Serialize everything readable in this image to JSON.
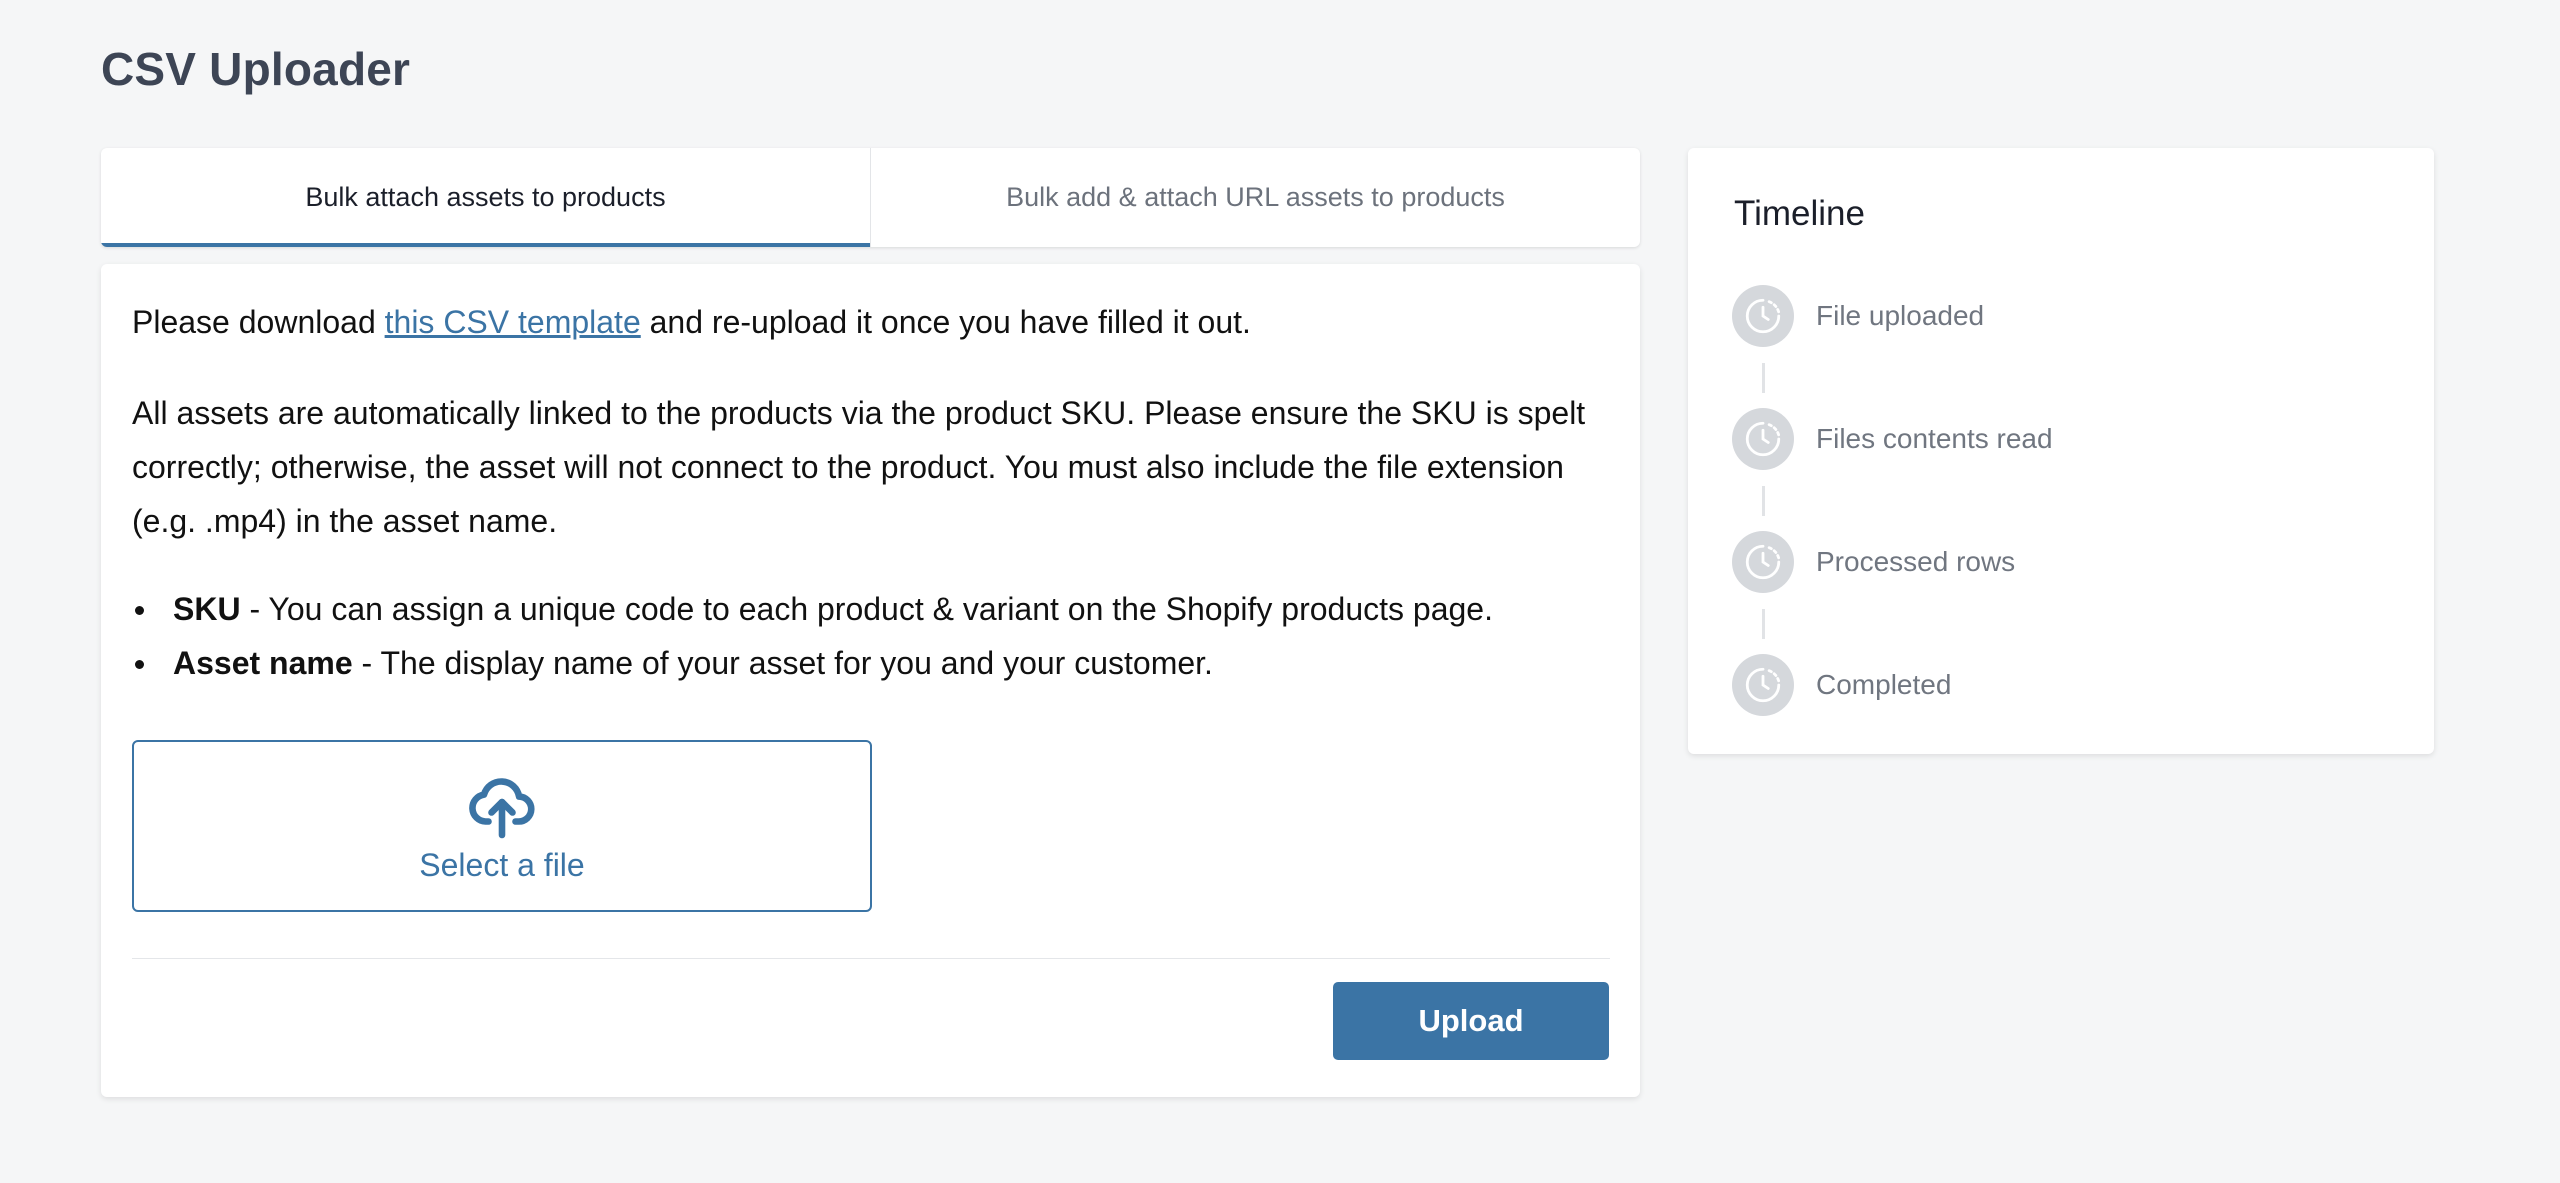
{
  "page": {
    "title": "CSV Uploader"
  },
  "tabs": [
    {
      "label": "Bulk attach assets to products",
      "active": true
    },
    {
      "label": "Bulk add & attach URL assets to products",
      "active": false
    }
  ],
  "content": {
    "intro_before": "Please download ",
    "intro_link": "this CSV template",
    "intro_after": " and re-upload it once you have filled it out.",
    "paragraph": "All assets are automatically linked to the products via the product SKU. Please ensure the SKU is spelt correctly; otherwise, the asset will not connect to the product. You must also include the file extension (e.g. .mp4) in the asset name.",
    "bullets": [
      {
        "term": "SKU",
        "text": " - You can assign a unique code to each product & variant on the Shopify products page."
      },
      {
        "term": "Asset name",
        "text": " - The display name of your asset for you and your customer."
      }
    ],
    "dropzone_label": "Select a file",
    "upload_label": "Upload"
  },
  "timeline": {
    "title": "Timeline",
    "steps": [
      {
        "label": "File uploaded",
        "icon": "pending-clock-icon"
      },
      {
        "label": "Files contents read",
        "icon": "pending-clock-icon"
      },
      {
        "label": "Processed rows",
        "icon": "pending-clock-icon"
      },
      {
        "label": "Completed",
        "icon": "pending-clock-icon"
      }
    ]
  },
  "colors": {
    "accent": "#3b74a5",
    "background": "#f5f6f7",
    "step_icon_bg": "#d5d8dc"
  }
}
